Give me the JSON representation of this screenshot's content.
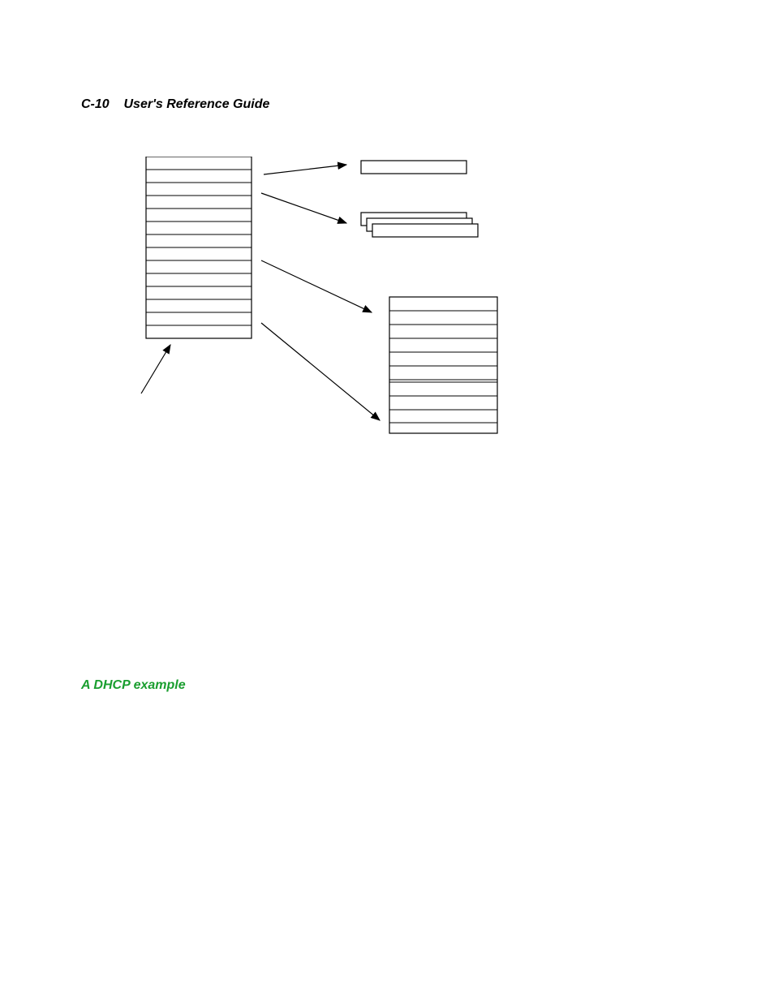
{
  "header": {
    "page_label": "C-10",
    "title": "User's Reference Guide"
  },
  "section": {
    "heading": "A DHCP example"
  },
  "diagram": {
    "left_stack_rows": 14,
    "right_top_box": 1,
    "right_mid_stack": 3,
    "right_bottom_rows": 10
  }
}
